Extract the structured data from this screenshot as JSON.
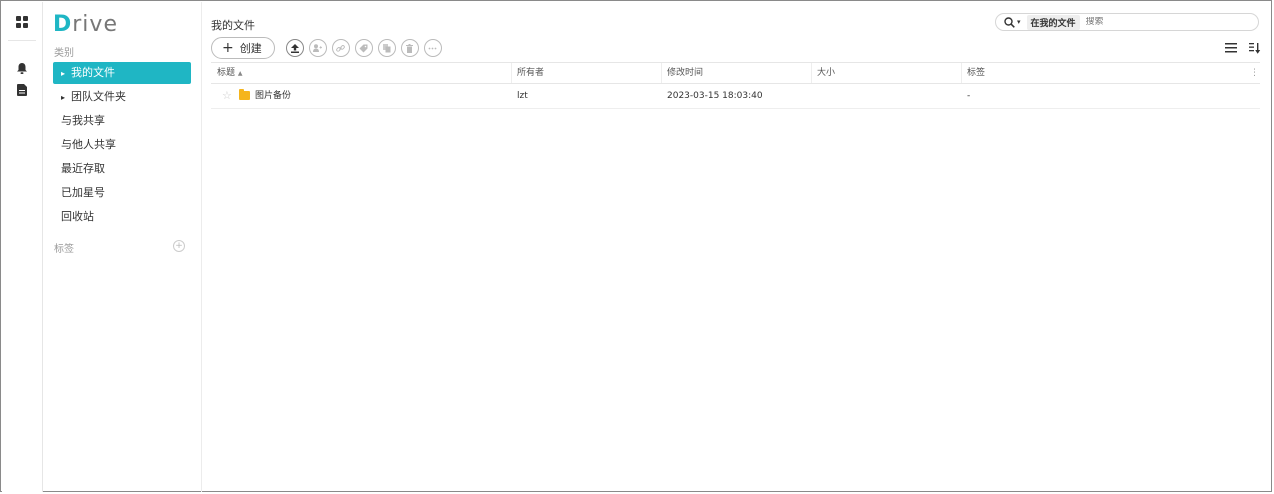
{
  "app": {
    "logo_d": "D",
    "logo_rest": "rive"
  },
  "rail": {
    "icons": [
      "apps-grid-icon",
      "bell-icon",
      "document-icon"
    ]
  },
  "sidebar": {
    "category_label": "类别",
    "items": [
      {
        "label": "我的文件",
        "active": true,
        "caret": "▸"
      },
      {
        "label": "团队文件夹",
        "active": false,
        "caret": "▸"
      },
      {
        "label": "与我共享",
        "active": false
      },
      {
        "label": "与他人共享",
        "active": false
      },
      {
        "label": "最近存取",
        "active": false
      },
      {
        "label": "已加星号",
        "active": false
      },
      {
        "label": "回收站",
        "active": false
      }
    ],
    "tags_label": "标签",
    "add_tag": "+"
  },
  "header": {
    "title": "我的文件",
    "search_scope": "在我的文件",
    "search_placeholder": "搜索"
  },
  "toolbar": {
    "create_label": "创建",
    "create_plus": "+"
  },
  "table": {
    "columns": [
      "标题",
      "所有者",
      "修改时间",
      "大小",
      "标签"
    ],
    "sort_indicator": "▲",
    "more": "⋮",
    "rows": [
      {
        "star": "☆",
        "name": "图片备份",
        "owner": "lzt",
        "modified": "2023-03-15 18:03:40",
        "size": "",
        "tags": "-"
      }
    ]
  },
  "colors": {
    "accent": "#1fb6c4",
    "folder": "#f5b51d"
  }
}
